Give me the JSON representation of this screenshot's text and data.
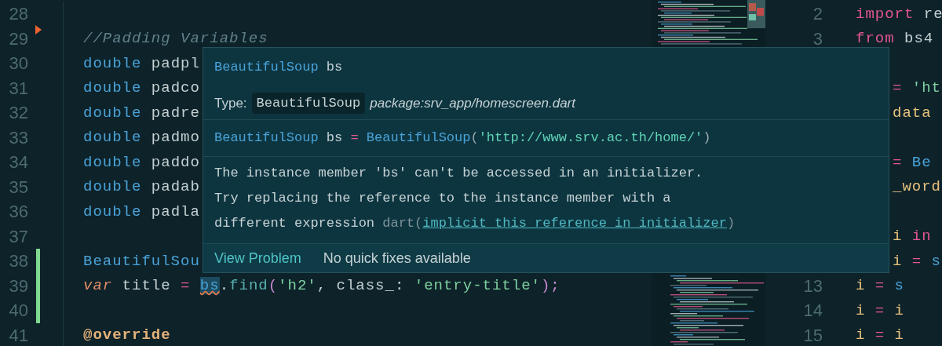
{
  "left_editor": {
    "lines": [
      {
        "number": "28",
        "added": false,
        "deleted": false
      },
      {
        "number": "29",
        "added": false,
        "deleted": true,
        "tokens": [
          {
            "text": "//Padding Variables",
            "kind": "comment"
          }
        ]
      },
      {
        "number": "30",
        "added": false,
        "deleted": false,
        "tokens": [
          {
            "text": "double",
            "kind": "keyword"
          },
          {
            "text": " padpl",
            "kind": "plain"
          }
        ]
      },
      {
        "number": "31",
        "added": false,
        "deleted": false,
        "tokens": [
          {
            "text": "double",
            "kind": "keyword"
          },
          {
            "text": " padco",
            "kind": "plain"
          }
        ]
      },
      {
        "number": "32",
        "added": false,
        "deleted": false,
        "tokens": [
          {
            "text": "double",
            "kind": "keyword"
          },
          {
            "text": " padre",
            "kind": "plain"
          }
        ]
      },
      {
        "number": "33",
        "added": false,
        "deleted": false,
        "tokens": [
          {
            "text": "double",
            "kind": "keyword"
          },
          {
            "text": " padmo",
            "kind": "plain"
          }
        ]
      },
      {
        "number": "34",
        "added": false,
        "deleted": false,
        "tokens": [
          {
            "text": "double",
            "kind": "keyword"
          },
          {
            "text": " paddo",
            "kind": "plain"
          }
        ]
      },
      {
        "number": "35",
        "added": false,
        "deleted": false,
        "tokens": [
          {
            "text": "double",
            "kind": "keyword"
          },
          {
            "text": " padab",
            "kind": "plain"
          }
        ]
      },
      {
        "number": "36",
        "added": false,
        "deleted": false,
        "tokens": [
          {
            "text": "double",
            "kind": "keyword"
          },
          {
            "text": " padla",
            "kind": "plain"
          }
        ]
      },
      {
        "number": "37",
        "added": false,
        "deleted": false
      },
      {
        "number": "38",
        "added": true,
        "deleted": false,
        "tokens": [
          {
            "text": "BeautifulSou",
            "kind": "type"
          }
        ]
      },
      {
        "number": "39",
        "added": true,
        "deleted": false,
        "tokens": [
          {
            "text": "var",
            "kind": "storage"
          },
          {
            "text": " title ",
            "kind": "plain"
          },
          {
            "text": "= ",
            "kind": "operator"
          },
          {
            "text": "bs",
            "kind": "error_ref"
          },
          {
            "text": ".",
            "kind": "plain"
          },
          {
            "text": "find",
            "kind": "method"
          },
          {
            "text": "(",
            "kind": "punct"
          },
          {
            "text": "'h2'",
            "kind": "string"
          },
          {
            "text": ", class_: ",
            "kind": "plain"
          },
          {
            "text": "'entry-title'",
            "kind": "string"
          },
          {
            "text": ");",
            "kind": "punct"
          }
        ]
      },
      {
        "number": "40",
        "added": true,
        "deleted": false
      },
      {
        "number": "41",
        "added": false,
        "deleted": false,
        "tokens": [
          {
            "text": "@override",
            "kind": "annotation"
          }
        ]
      }
    ]
  },
  "right_editor": {
    "lines": [
      {
        "kind": "line",
        "number": "2",
        "tokens": [
          {
            "text": "import",
            "kind": "control"
          },
          {
            "text": " re",
            "kind": "plain"
          }
        ]
      },
      {
        "kind": "line",
        "number": "3",
        "tokens": [
          {
            "text": "from",
            "kind": "control"
          },
          {
            "text": " bs4",
            "kind": "plain"
          }
        ]
      },
      {
        "kind": "blank"
      },
      {
        "kind": "partial",
        "tokens": [
          {
            "text": "=",
            "kind": "operator"
          },
          {
            "text": " 'ht",
            "kind": "string"
          }
        ]
      },
      {
        "kind": "partial",
        "tokens": [
          {
            "text": "data",
            "kind": "variable"
          }
        ]
      },
      {
        "kind": "blank"
      },
      {
        "kind": "partial",
        "tokens": [
          {
            "text": "=",
            "kind": "operator"
          },
          {
            "text": " Be",
            "kind": "type"
          }
        ]
      },
      {
        "kind": "partial",
        "tokens": [
          {
            "text": "_word",
            "kind": "variable"
          }
        ]
      },
      {
        "kind": "blank"
      },
      {
        "kind": "partial",
        "tokens": [
          {
            "text": "i",
            "kind": "variable"
          },
          {
            "text": " in",
            "kind": "control"
          }
        ]
      },
      {
        "kind": "partial",
        "tokens": [
          {
            "text": "i",
            "kind": "variable"
          },
          {
            "text": " =",
            "kind": "operator"
          },
          {
            "text": " s",
            "kind": "type"
          }
        ]
      },
      {
        "kind": "line",
        "number": "13",
        "tokens": [
          {
            "text": "i",
            "kind": "variable"
          },
          {
            "text": " =",
            "kind": "operator"
          },
          {
            "text": " s",
            "kind": "type"
          }
        ]
      },
      {
        "kind": "line",
        "number": "14",
        "tokens": [
          {
            "text": "i",
            "kind": "variable"
          },
          {
            "text": " =",
            "kind": "operator"
          },
          {
            "text": " i",
            "kind": "variable"
          }
        ]
      },
      {
        "kind": "line",
        "number": "15",
        "tokens": [
          {
            "text": "i",
            "kind": "variable"
          },
          {
            "text": " =",
            "kind": "operator"
          },
          {
            "text": " i",
            "kind": "variable"
          }
        ]
      }
    ]
  },
  "hover_popup": {
    "declaration": [
      {
        "text": "BeautifulSoup",
        "kind": "type"
      },
      {
        "text": " bs",
        "kind": "plain"
      }
    ],
    "type_label": "Type:",
    "type_name": "BeautifulSoup",
    "type_source": "package:srv_app/homescreen.dart",
    "signature": [
      {
        "text": "BeautifulSoup",
        "kind": "type"
      },
      {
        "text": " bs ",
        "kind": "plain"
      },
      {
        "text": "= ",
        "kind": "operator"
      },
      {
        "text": "BeautifulSoup",
        "kind": "type"
      },
      {
        "text": "(",
        "kind": "paren"
      },
      {
        "text": "'http://www.srv.ac.th/home/'",
        "kind": "string"
      },
      {
        "text": ")",
        "kind": "paren"
      }
    ],
    "message": "The instance member 'bs' can't be accessed in an initializer.\nTry replacing the reference to the instance member with a different expression",
    "message_source": "dart(",
    "rule_link": "implicit_this_reference_in_initializer",
    "message_close": ")",
    "footer": {
      "link": "View Problem",
      "note": "No quick fixes available"
    }
  }
}
